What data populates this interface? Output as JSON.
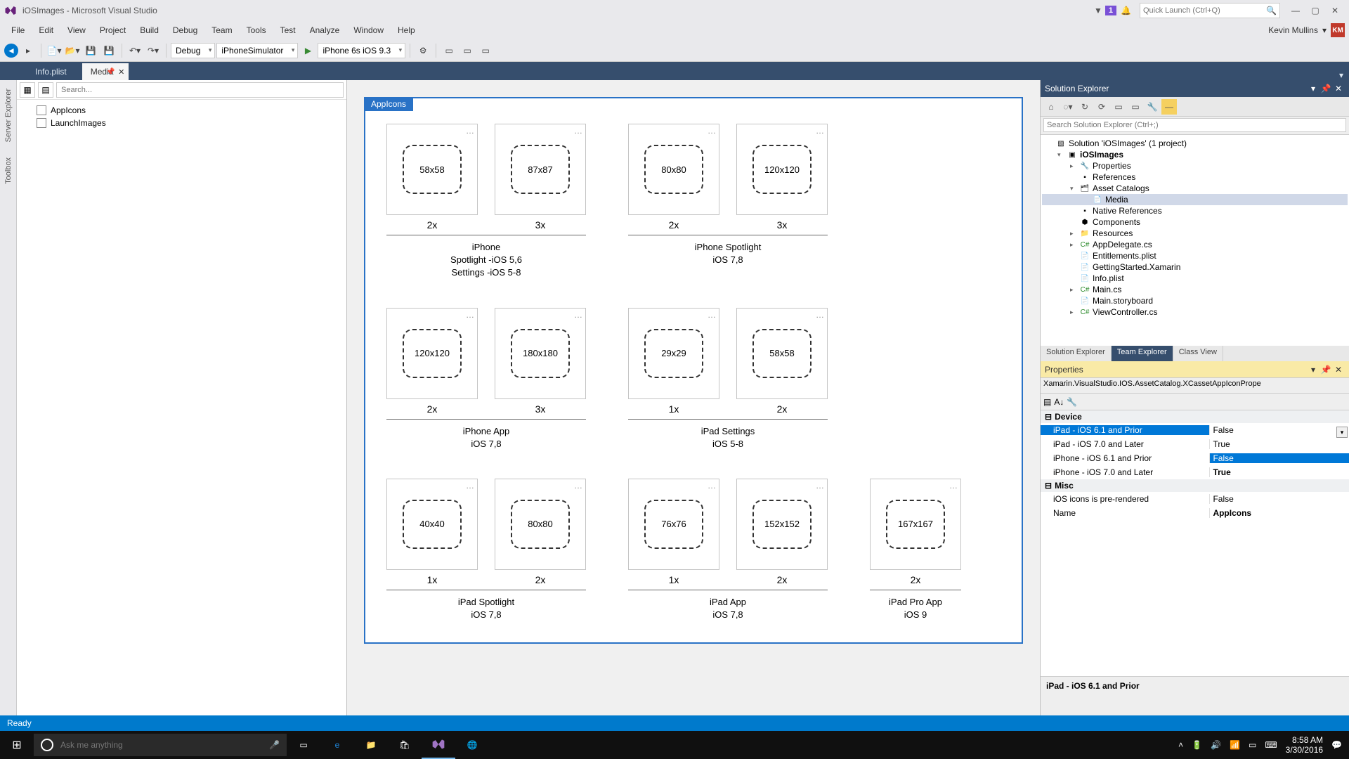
{
  "title": "iOSImages - Microsoft Visual Studio",
  "notifBadge": "1",
  "quickLaunchPlaceholder": "Quick Launch (Ctrl+Q)",
  "menu": [
    "File",
    "Edit",
    "View",
    "Project",
    "Build",
    "Debug",
    "Team",
    "Tools",
    "Test",
    "Analyze",
    "Window",
    "Help"
  ],
  "user": {
    "name": "Kevin Mullins",
    "initials": "KM"
  },
  "toolbar": {
    "config": "Debug",
    "platform": "iPhoneSimulator",
    "device": "iPhone 6s iOS 9.3"
  },
  "tabs": [
    {
      "label": "Info.plist",
      "active": false
    },
    {
      "label": "Media",
      "active": true
    }
  ],
  "leftRail": [
    "Server Explorer",
    "Toolbox"
  ],
  "leftSearchPlaceholder": "Search...",
  "leftTree": [
    {
      "label": "AppIcons"
    },
    {
      "label": "LaunchImages"
    }
  ],
  "catalogLabel": "AppIcons",
  "groups": [
    {
      "title": "iPhone\nSpotlight -iOS 5,6\nSettings -iOS 5-8",
      "slots": [
        {
          "size": "58x58",
          "scale": "2x"
        },
        {
          "size": "87x87",
          "scale": "3x"
        }
      ]
    },
    {
      "title": "iPhone Spotlight\niOS 7,8",
      "slots": [
        {
          "size": "80x80",
          "scale": "2x"
        },
        {
          "size": "120x120",
          "scale": "3x"
        }
      ]
    },
    {
      "title": "iPhone App\niOS 7,8",
      "slots": [
        {
          "size": "120x120",
          "scale": "2x"
        },
        {
          "size": "180x180",
          "scale": "3x"
        }
      ]
    },
    {
      "title": "iPad Settings\niOS 5-8",
      "slots": [
        {
          "size": "29x29",
          "scale": "1x"
        },
        {
          "size": "58x58",
          "scale": "2x"
        }
      ]
    },
    {
      "title": "iPad Spotlight\niOS 7,8",
      "slots": [
        {
          "size": "40x40",
          "scale": "1x"
        },
        {
          "size": "80x80",
          "scale": "2x"
        }
      ]
    },
    {
      "title": "iPad App\niOS 7,8",
      "slots": [
        {
          "size": "76x76",
          "scale": "1x"
        },
        {
          "size": "152x152",
          "scale": "2x"
        }
      ]
    },
    {
      "title": "iPad Pro App\niOS 9",
      "slots": [
        {
          "size": "167x167",
          "scale": "2x"
        }
      ]
    }
  ],
  "solutionExplorer": {
    "title": "Solution Explorer",
    "searchPlaceholder": "Search Solution Explorer (Ctrl+;)",
    "rootLabel": "Solution 'iOSImages' (1 project)",
    "project": "iOSImages",
    "nodes": [
      {
        "label": "Properties",
        "indent": 2,
        "exp": "▸",
        "ico": "🔧"
      },
      {
        "label": "References",
        "indent": 2,
        "exp": "",
        "ico": "▪"
      },
      {
        "label": "Asset Catalogs",
        "indent": 2,
        "exp": "▾",
        "ico": "🗂"
      },
      {
        "label": "Media",
        "indent": 3,
        "exp": "",
        "ico": "📄",
        "selected": true
      },
      {
        "label": "Native References",
        "indent": 2,
        "exp": "",
        "ico": "▪"
      },
      {
        "label": "Components",
        "indent": 2,
        "exp": "",
        "ico": "⬢"
      },
      {
        "label": "Resources",
        "indent": 2,
        "exp": "▸",
        "ico": "📁"
      },
      {
        "label": "AppDelegate.cs",
        "indent": 2,
        "exp": "▸",
        "ico": "C#"
      },
      {
        "label": "Entitlements.plist",
        "indent": 2,
        "exp": "",
        "ico": "📄"
      },
      {
        "label": "GettingStarted.Xamarin",
        "indent": 2,
        "exp": "",
        "ico": "📄"
      },
      {
        "label": "Info.plist",
        "indent": 2,
        "exp": "",
        "ico": "📄"
      },
      {
        "label": "Main.cs",
        "indent": 2,
        "exp": "▸",
        "ico": "C#"
      },
      {
        "label": "Main.storyboard",
        "indent": 2,
        "exp": "",
        "ico": "📄"
      },
      {
        "label": "ViewController.cs",
        "indent": 2,
        "exp": "▸",
        "ico": "C#"
      }
    ],
    "bottomTabs": [
      "Solution Explorer",
      "Team Explorer",
      "Class View"
    ]
  },
  "properties": {
    "title": "Properties",
    "typeName": "Xamarin.VisualStudio.IOS.AssetCatalog.XCassetAppIconPrope",
    "catDevice": "Device",
    "rows": [
      {
        "name": "iPad - iOS 6.1 and Prior",
        "value": "False",
        "hlName": true,
        "dd": true
      },
      {
        "name": "iPad - iOS 7.0 and Later",
        "value": "True"
      },
      {
        "name": "iPhone - iOS 6.1 and Prior",
        "value": "False",
        "hlVal": true
      },
      {
        "name": "iPhone - iOS 7.0 and Later",
        "value": "True",
        "bold": true
      }
    ],
    "catMisc": "Misc",
    "miscRows": [
      {
        "name": "iOS icons is pre-rendered",
        "value": "False"
      },
      {
        "name": "Name",
        "value": "AppIcons",
        "bold": true
      }
    ],
    "desc": "iPad - iOS 6.1 and Prior"
  },
  "status": "Ready",
  "taskbar": {
    "cortana": "Ask me anything",
    "time": "8:58 AM",
    "date": "3/30/2016"
  }
}
